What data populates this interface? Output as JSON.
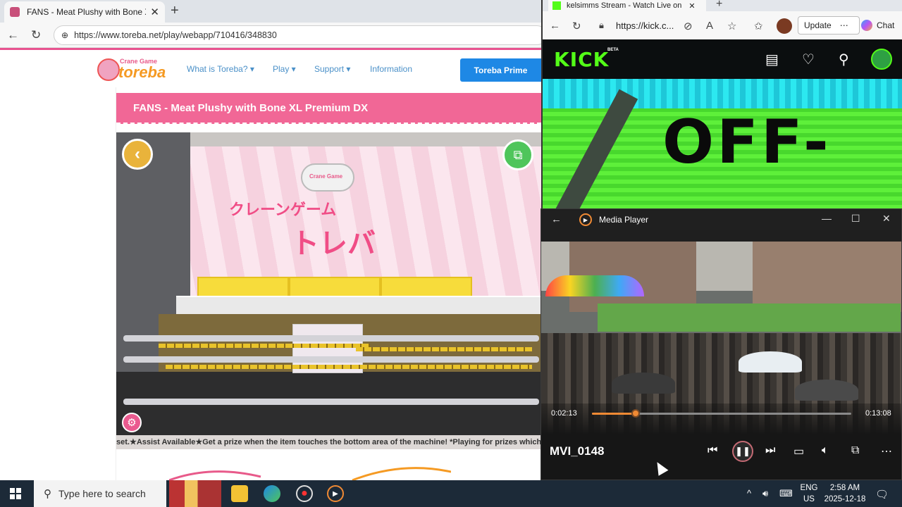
{
  "left_browser": {
    "tab_title": "FANS - Meat Plushy with Bone XL",
    "url": "https://www.toreba.net/play/webapp/710416/348830",
    "logo_top": "Crane Game",
    "logo_main": "toreba",
    "menu": [
      "What is Toreba?",
      "Play",
      "Support",
      "Information"
    ],
    "prime_button": "Toreba Prime",
    "page_title": "FANS - Meat Plushy with Bone XL Premium DX",
    "machine_sign_top": "クレーンゲーム",
    "machine_sign_main": "トレバ",
    "claw_label": "Crane Game",
    "ticker": "set.★Assist Available★Get a prize when the item touches the bottom area of the machine! *Playing for prizes which had"
  },
  "right_browser": {
    "tab_title": "kelsimms Stream - Watch Live on",
    "url": "https://kick.c...",
    "update_label": "Update",
    "chat_label": "Chat",
    "kick_logo": "KICK",
    "kick_beta": "BETA",
    "offline_text": "OFF-"
  },
  "media_player": {
    "title": "Media Player",
    "current_time": "0:02:13",
    "total_time": "0:13:08",
    "progress": 0.169,
    "filename": "MVI_0148"
  },
  "taskbar": {
    "search_placeholder": "Type here to search",
    "lang_top": "ENG",
    "lang_bottom": "US",
    "time": "2:58 AM",
    "date": "2025-12-18"
  },
  "colors": {
    "toreba_pink": "#f16796",
    "toreba_blue": "#1e88e5",
    "kick_green": "#53fc18",
    "player_accent": "#f08a34"
  }
}
